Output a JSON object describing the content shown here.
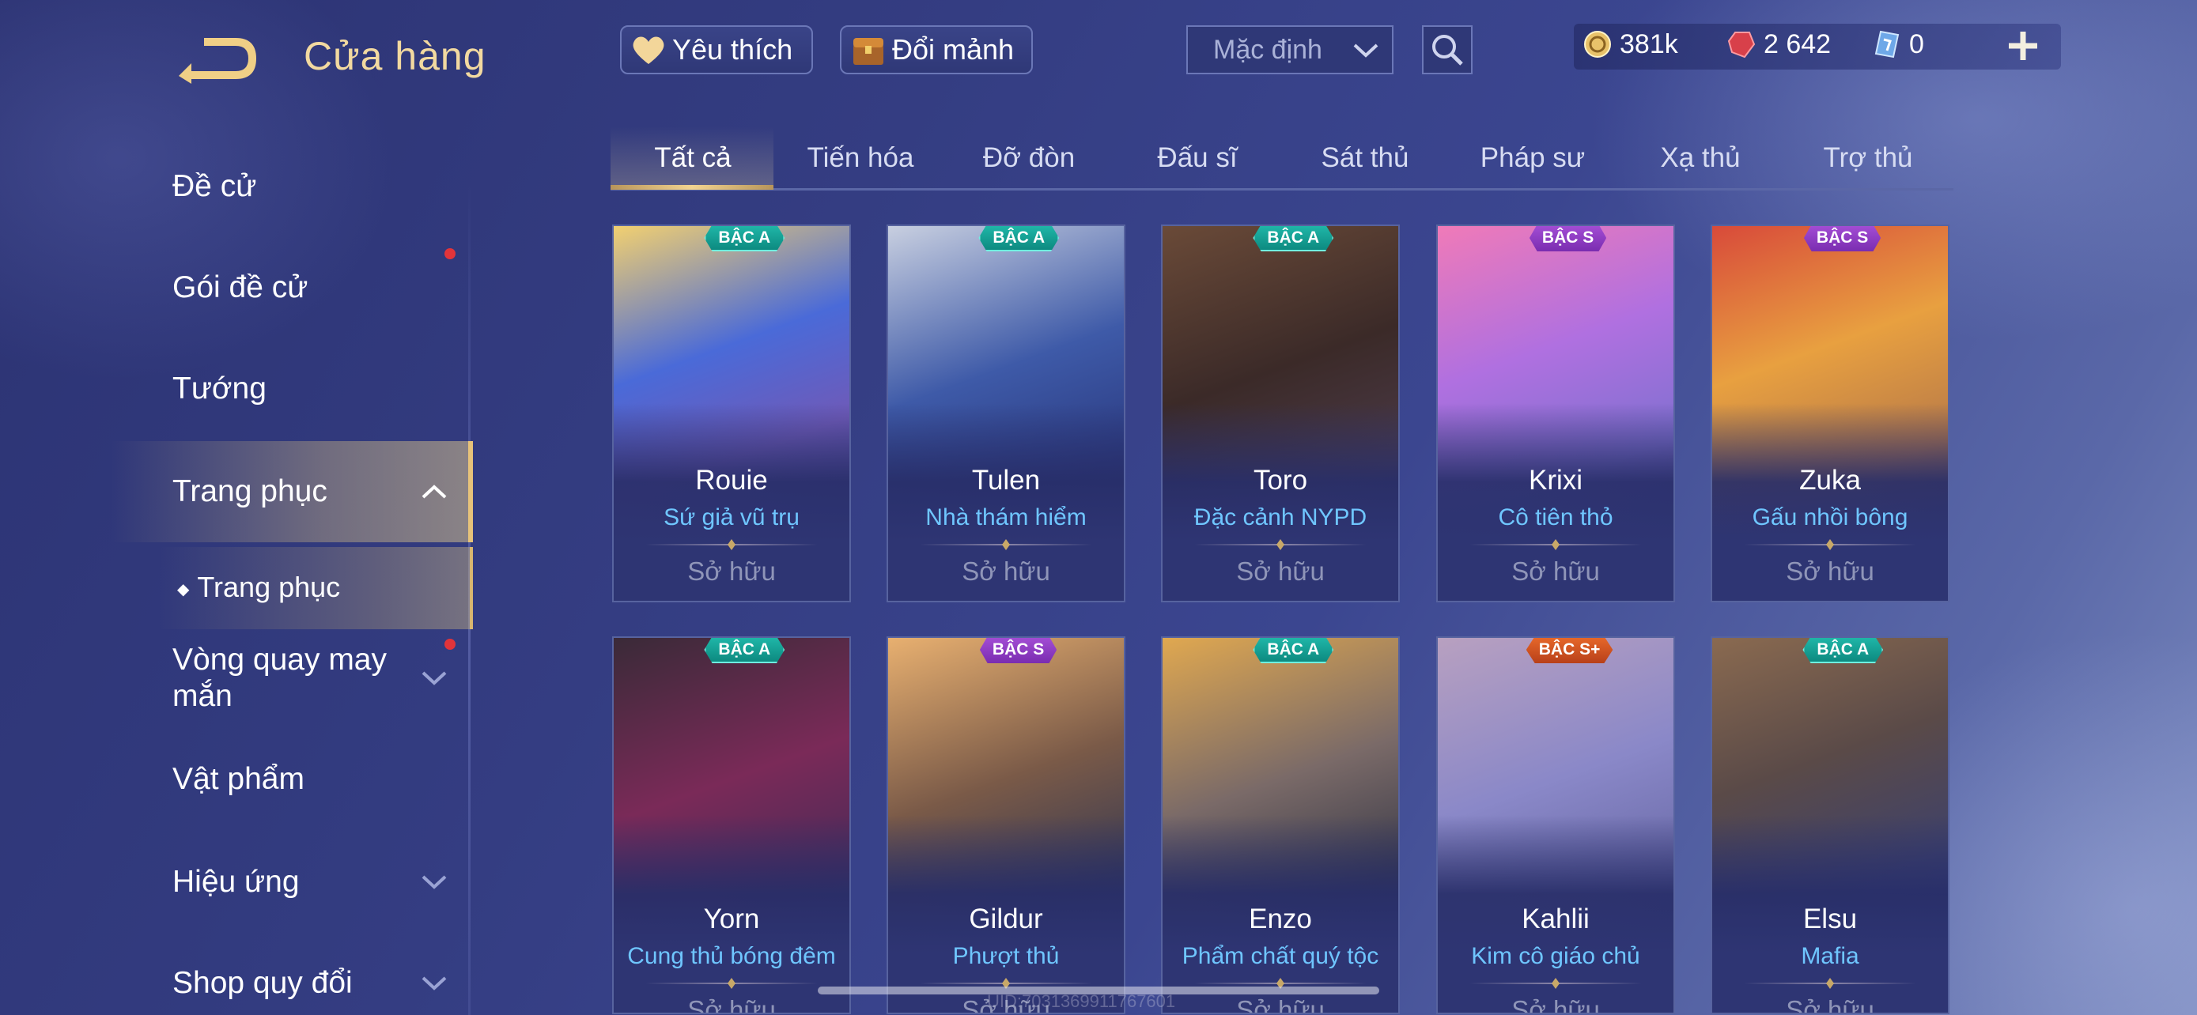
{
  "header": {
    "title": "Cửa hàng",
    "favorites_label": "Yêu thích",
    "fragments_label": "Đổi mảnh",
    "sort_value": "Mặc định",
    "currency": {
      "gold": "381k",
      "ruby": "2 642",
      "coupon": "0"
    }
  },
  "sidebar": {
    "items": [
      {
        "label": "Đề cử"
      },
      {
        "label": "Gói đề cử"
      },
      {
        "label": "Tướng"
      },
      {
        "label": "Trang phục"
      },
      {
        "label": "Vòng quay may mắn"
      },
      {
        "label": "Vật phẩm"
      },
      {
        "label": "Hiệu ứng"
      },
      {
        "label": "Shop quy đổi"
      }
    ],
    "sub_item": {
      "bullet": "◆",
      "label": "Trang phục"
    }
  },
  "tabs": [
    {
      "label": "Tất cả"
    },
    {
      "label": "Tiến hóa"
    },
    {
      "label": "Đỡ đòn"
    },
    {
      "label": "Đấu sĩ"
    },
    {
      "label": "Sát thủ"
    },
    {
      "label": "Pháp sư"
    },
    {
      "label": "Xạ thủ"
    },
    {
      "label": "Trợ thủ"
    }
  ],
  "cards": [
    {
      "tier": "BẬC A",
      "hero": "Rouie",
      "skin": "Sứ giả vũ trụ",
      "status": "Sở hữu"
    },
    {
      "tier": "BẬC A",
      "hero": "Tulen",
      "skin": "Nhà thám hiểm",
      "status": "Sở hữu"
    },
    {
      "tier": "BẬC A",
      "hero": "Toro",
      "skin": "Đặc cảnh NYPD",
      "status": "Sở hữu"
    },
    {
      "tier": "BẬC S",
      "hero": "Krixi",
      "skin": "Cô tiên thỏ",
      "status": "Sở hữu"
    },
    {
      "tier": "BẬC S",
      "hero": "Zuka",
      "skin": "Gấu nhồi bông",
      "status": "Sở hữu"
    },
    {
      "tier": "BẬC A",
      "hero": "Yorn",
      "skin": "Cung thủ bóng đêm",
      "status": "Sở hữu"
    },
    {
      "tier": "BẬC S",
      "hero": "Gildur",
      "skin": "Phượt thủ",
      "status": "Sở hữu"
    },
    {
      "tier": "BẬC A",
      "hero": "Enzo",
      "skin": "Phẩm chất quý tộc",
      "status": "Sở hữu"
    },
    {
      "tier": "BẬC S+",
      "hero": "Kahlii",
      "skin": "Kim cô giáo chủ",
      "status": "Sở hữu"
    },
    {
      "tier": "BẬC A",
      "hero": "Elsu",
      "skin": "Mafia",
      "status": "Sở hữu"
    }
  ],
  "watermark": "UID:7031369911767601",
  "colors": {
    "accent_gold": "#e6c27a",
    "skin_name": "#6fc6ff",
    "tier_a": "#1fb6a8",
    "tier_s": "#a54ed6",
    "tier_s_plus": "#e8692a",
    "notification": "#e2343a"
  }
}
